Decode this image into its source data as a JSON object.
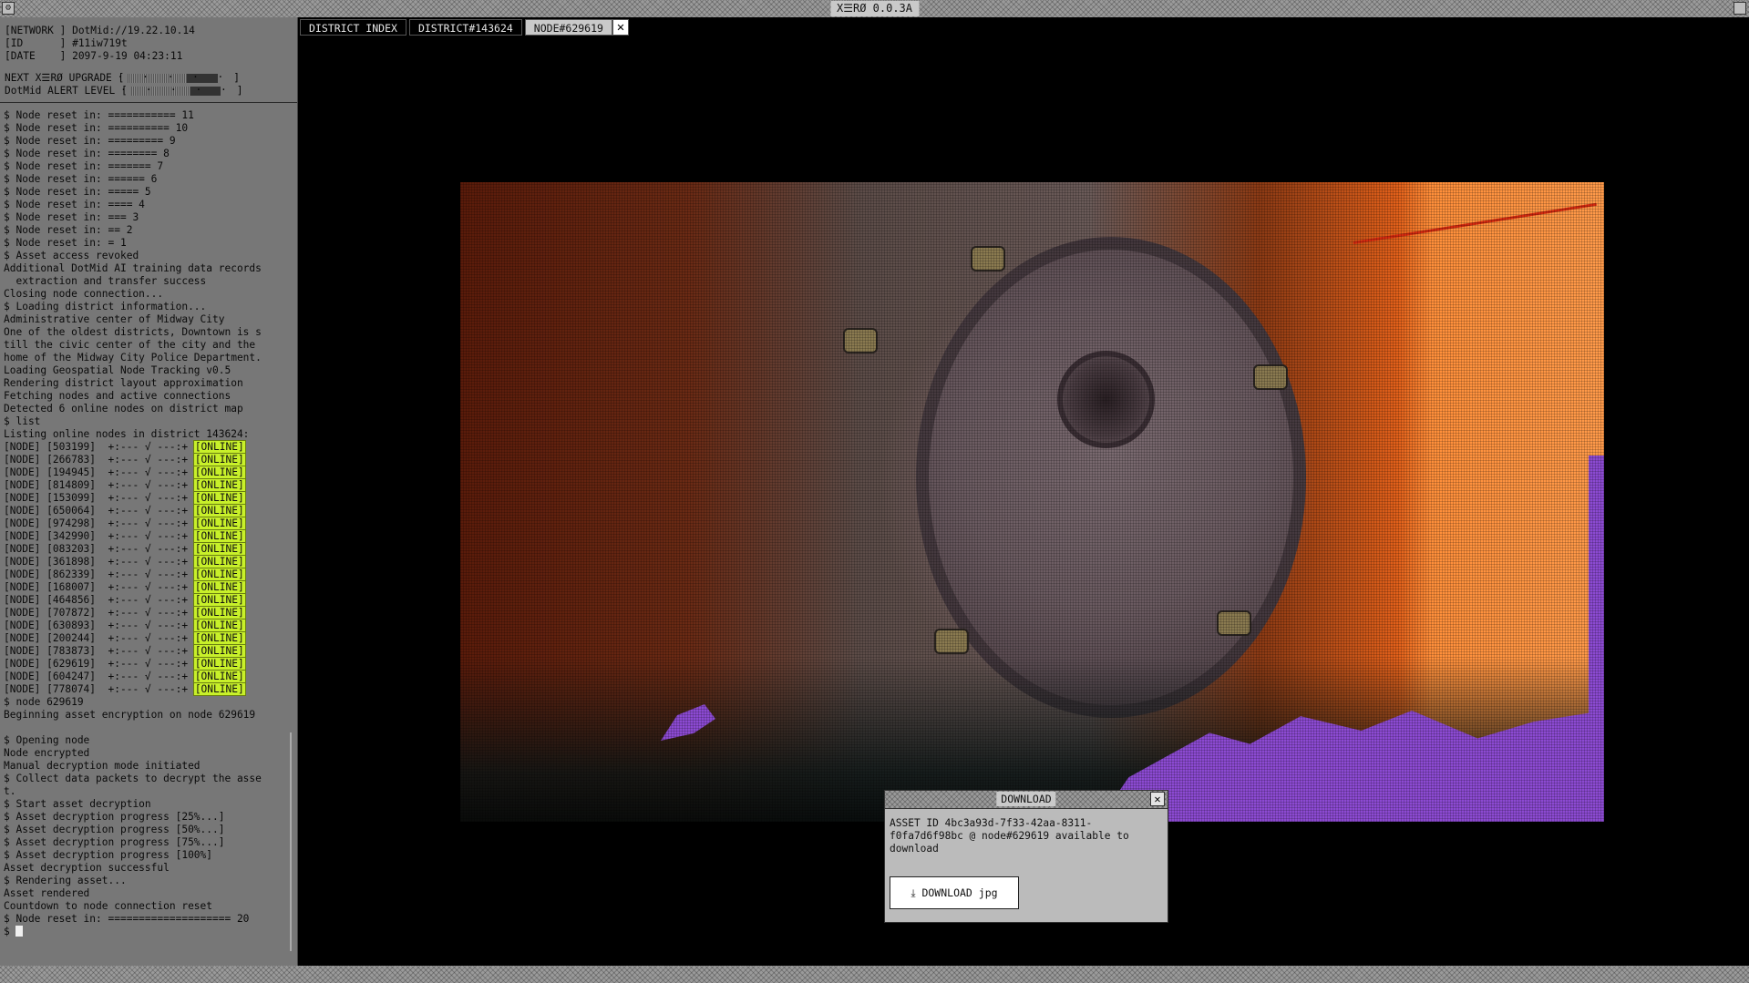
{
  "window": {
    "title": "X☰RØ 0.0.3A"
  },
  "terminal": {
    "header": [
      "[NETWORK ] DotMid://19.22.10.14",
      "[ID      ] #11iw719t",
      "[DATE    ] 2097-9-19 04:23:11"
    ],
    "meters": [
      {
        "label": "NEXT X☰RØ UPGRADE [",
        "level": 0.58,
        "end": "]"
      },
      {
        "label": "DotMid ALERT LEVEL [",
        "level": 0.58,
        "end": "]"
      }
    ],
    "meter_dots": "· · · · ·",
    "log_before": [
      "$ Node reset in: =========== 11",
      "$ Node reset in: ========== 10",
      "$ Node reset in: ========= 9",
      "$ Node reset in: ======== 8",
      "$ Node reset in: ======= 7",
      "$ Node reset in: ====== 6",
      "$ Node reset in: ===== 5",
      "$ Node reset in: ==== 4",
      "$ Node reset in: === 3",
      "$ Node reset in: == 2",
      "$ Node reset in: = 1",
      "$ Asset access revoked",
      "Additional DotMid AI training data records",
      "  extraction and transfer success",
      "Closing node connection...",
      "$ Loading district information...",
      "Administrative center of Midway City",
      "One of the oldest districts, Downtown is s",
      "till the civic center of the city and the",
      "home of the Midway City Police Department.",
      "Loading Geospatial Node Tracking v0.5",
      "Rendering district layout approximation",
      "Fetching nodes and active connections",
      "Detected 6 online nodes on district map",
      "$ list",
      "Listing online nodes in district 143624:"
    ],
    "nodes": [
      {
        "prefix": "[NODE] [503199]  +:--- √ ---:+ ",
        "status": "[ONLINE]"
      },
      {
        "prefix": "[NODE] [266783]  +:--- √ ---:+ ",
        "status": "[ONLINE]"
      },
      {
        "prefix": "[NODE] [194945]  +:--- √ ---:+ ",
        "status": "[ONLINE]"
      },
      {
        "prefix": "[NODE] [814809]  +:--- √ ---:+ ",
        "status": "[ONLINE]"
      },
      {
        "prefix": "[NODE] [153099]  +:--- √ ---:+ ",
        "status": "[ONLINE]"
      },
      {
        "prefix": "[NODE] [650064]  +:--- √ ---:+ ",
        "status": "[ONLINE]"
      },
      {
        "prefix": "[NODE] [974298]  +:--- √ ---:+ ",
        "status": "[ONLINE]"
      },
      {
        "prefix": "[NODE] [342990]  +:--- √ ---:+ ",
        "status": "[ONLINE]"
      },
      {
        "prefix": "[NODE] [083203]  +:--- √ ---:+ ",
        "status": "[ONLINE]"
      },
      {
        "prefix": "[NODE] [361898]  +:--- √ ---:+ ",
        "status": "[ONLINE]"
      },
      {
        "prefix": "[NODE] [862339]  +:--- √ ---:+ ",
        "status": "[ONLINE]"
      },
      {
        "prefix": "[NODE] [168007]  +:--- √ ---:+ ",
        "status": "[ONLINE]"
      },
      {
        "prefix": "[NODE] [464856]  +:--- √ ---:+ ",
        "status": "[ONLINE]"
      },
      {
        "prefix": "[NODE] [707872]  +:--- √ ---:+ ",
        "status": "[ONLINE]"
      },
      {
        "prefix": "[NODE] [630893]  +:--- √ ---:+ ",
        "status": "[ONLINE]"
      },
      {
        "prefix": "[NODE] [200244]  +:--- √ ---:+ ",
        "status": "[ONLINE]"
      },
      {
        "prefix": "[NODE] [783873]  +:--- √ ---:+ ",
        "status": "[ONLINE]"
      },
      {
        "prefix": "[NODE] [629619]  +:--- √ ---:+ ",
        "status": "[ONLINE]"
      },
      {
        "prefix": "[NODE] [604247]  +:--- √ ---:+ ",
        "status": "[ONLINE]"
      },
      {
        "prefix": "[NODE] [778074]  +:--- √ ---:+ ",
        "status": "[ONLINE]"
      }
    ],
    "log_after": [
      "$ node 629619",
      "Beginning asset encryption on node 629619",
      "",
      "$ Opening node",
      "Node encrypted",
      "Manual decryption mode initiated",
      "$ Collect data packets to decrypt the asse",
      "t.",
      "$ Start asset decryption",
      "$ Asset decryption progress [25%...]",
      "$ Asset decryption progress [50%...]",
      "$ Asset decryption progress [75%...]",
      "$ Asset decryption progress [100%]",
      "Asset decryption successful",
      "$ Rendering asset...",
      "Asset rendered",
      "Countdown to node connection reset",
      "$ Node reset in: ==================== 20"
    ],
    "prompt": "$ "
  },
  "tabs": [
    {
      "label": "DISTRICT INDEX",
      "active": false
    },
    {
      "label": "DISTRICT#143624",
      "active": false
    },
    {
      "label": "NODE#629619",
      "active": true
    }
  ],
  "tab_close_glyph": "✕",
  "download": {
    "title": "DOWNLOAD",
    "close_glyph": "✕",
    "message": "ASSET ID 4bc3a93d-7f33-42aa-8311-f0fa7d6f98bc @ node#629619 available to download",
    "button_label": "⤓  DOWNLOAD jpg",
    "download_icon": "download-icon"
  },
  "colors": {
    "online_badge": "#c8f02a",
    "accent_orange": "#ff8f3a",
    "accent_purple": "#8c4ad2"
  }
}
